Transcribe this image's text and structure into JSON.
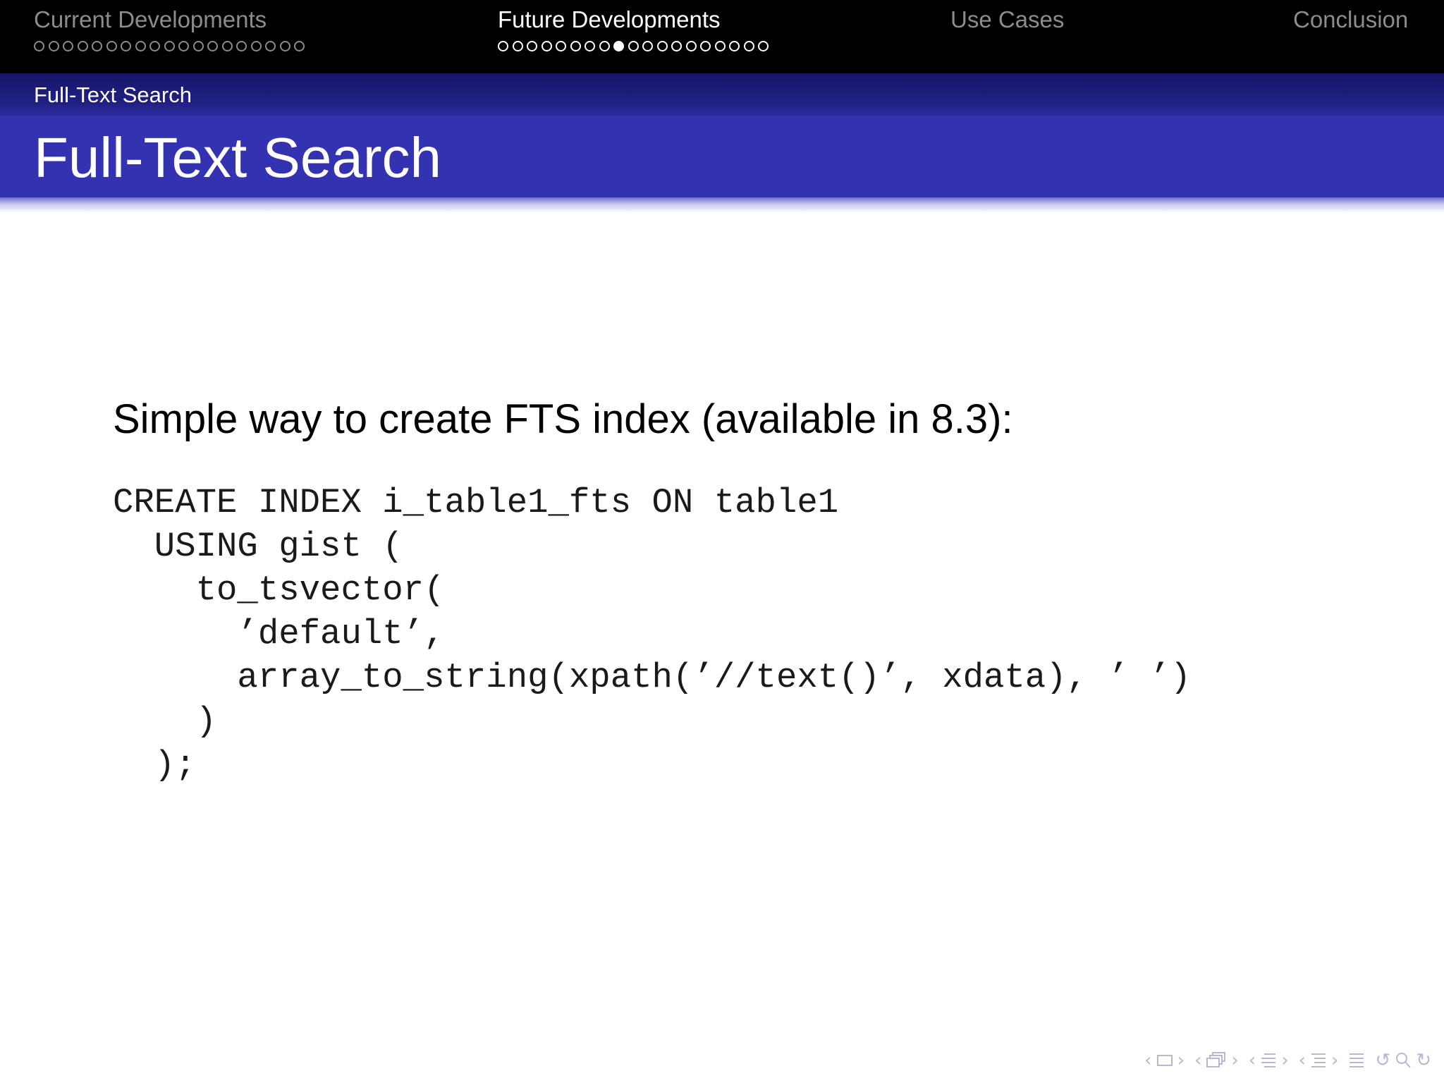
{
  "nav": {
    "sections": [
      {
        "label": "Current Developments",
        "dots": 19,
        "active": false,
        "current_index": -1
      },
      {
        "label": "Future Developments",
        "dots": 19,
        "active": true,
        "current_index": 8
      },
      {
        "label": "Use Cases",
        "dots": 0,
        "active": false,
        "current_index": -1
      },
      {
        "label": "Conclusion",
        "dots": 0,
        "active": false,
        "current_index": -1
      }
    ]
  },
  "subsection": {
    "label": "Full-Text Search"
  },
  "frame": {
    "title": "Full-Text Search"
  },
  "content": {
    "intro": "Simple way to create FTS index (available in 8.3):",
    "code_lines": [
      "CREATE INDEX i_table1_fts ON table1",
      "  USING gist (",
      "    to_tsvector(",
      "      ’default’,",
      "      array_to_string(xpath(’//text()’, xdata), ’ ’)",
      "    )",
      "  );"
    ]
  },
  "colors": {
    "nav_bg": "#000000",
    "nav_inactive": "#8c8c8c",
    "nav_active": "#ffffff",
    "subsection_bg": "#1d1d7e",
    "title_bg": "#3333b2",
    "nav_symbols": "#b7b7d6"
  },
  "nav_symbols": [
    "arrow-left-icon",
    "frame-icon",
    "arrow-right-icon",
    "arrow-left-icon",
    "slides-icon",
    "arrow-right-icon",
    "arrow-left-icon",
    "subsection-icon",
    "arrow-right-icon",
    "arrow-left-icon",
    "section-icon",
    "arrow-right-icon",
    "appendix-icon",
    "back-icon",
    "search-icon",
    "forward-icon"
  ]
}
